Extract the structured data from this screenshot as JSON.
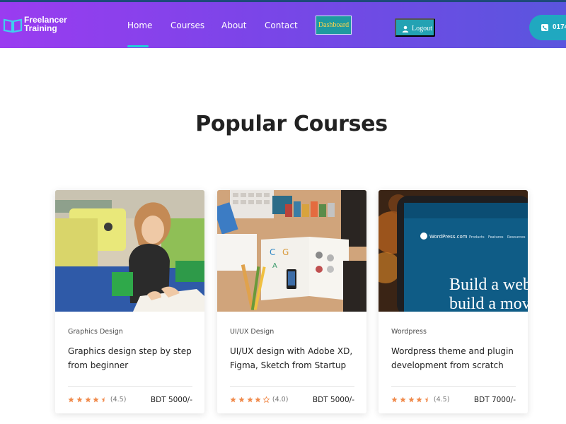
{
  "brand": {
    "line1": "Freelancer",
    "line2": "Training"
  },
  "nav": {
    "items": [
      {
        "label": "Home",
        "active": true
      },
      {
        "label": "Courses",
        "active": false
      },
      {
        "label": "About",
        "active": false
      },
      {
        "label": "Contact",
        "active": false
      }
    ],
    "dashboard_label": "Dashboard",
    "logout_label": "Logout",
    "phone_label": "0174"
  },
  "section": {
    "title": "Popular Courses"
  },
  "courses": [
    {
      "category": "Graphics Design",
      "title": "Graphics design step by step from beginner",
      "rating": 4.5,
      "rating_label": "(4.5)",
      "price": "BDT 5000/-"
    },
    {
      "category": "UI/UX Design",
      "title": "UI/UX design with Adobe XD, Figma, Sketch from Startup",
      "rating": 4.0,
      "rating_label": "(4.0)",
      "price": "BDT 5000/-"
    },
    {
      "category": "Wordpress",
      "title": "Wordpress theme and plugin development from scratch",
      "rating": 4.5,
      "rating_label": "(4.5)",
      "price": "BDT 7000/-",
      "image_text": {
        "brand": "WordPress.com",
        "menu": [
          "Products",
          "Features",
          "Resources"
        ],
        "headline1": "Build a webs",
        "headline2": "build a mov"
      }
    }
  ],
  "colors": {
    "header_start": "#9a3cf0",
    "header_end": "#5a55de",
    "accent_teal": "#23a2b3",
    "star": "#f08a4b"
  }
}
